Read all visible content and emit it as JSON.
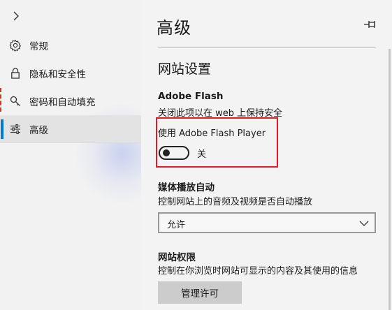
{
  "sidebar": {
    "items": [
      {
        "label": "常规",
        "icon": "gear-icon"
      },
      {
        "label": "隐私和安全性",
        "icon": "lock-icon"
      },
      {
        "label": "密码和自动填充",
        "icon": "key-icon"
      },
      {
        "label": "高级",
        "icon": "sliders-icon"
      }
    ],
    "active_index": 3
  },
  "header": {
    "title": "高级"
  },
  "website_settings": {
    "title": "网站设置"
  },
  "adobe_flash": {
    "heading": "Adobe Flash",
    "description": "关闭此项以在 web 上保持安全",
    "toggle_label": "使用 Adobe Flash Player",
    "toggle_state": "关",
    "toggle_on": false
  },
  "media_autoplay": {
    "heading": "媒体播放自动",
    "description": "控制网站上的音频及视频是否自动播放",
    "selected_option": "允许"
  },
  "site_permissions": {
    "heading": "网站权限",
    "description": "控制在你浏览时网站可显示的内容及其使用的信息",
    "manage_label": "管理许可"
  },
  "colors": {
    "accent": "#0078d7",
    "highlight_box": "#e01b22"
  }
}
